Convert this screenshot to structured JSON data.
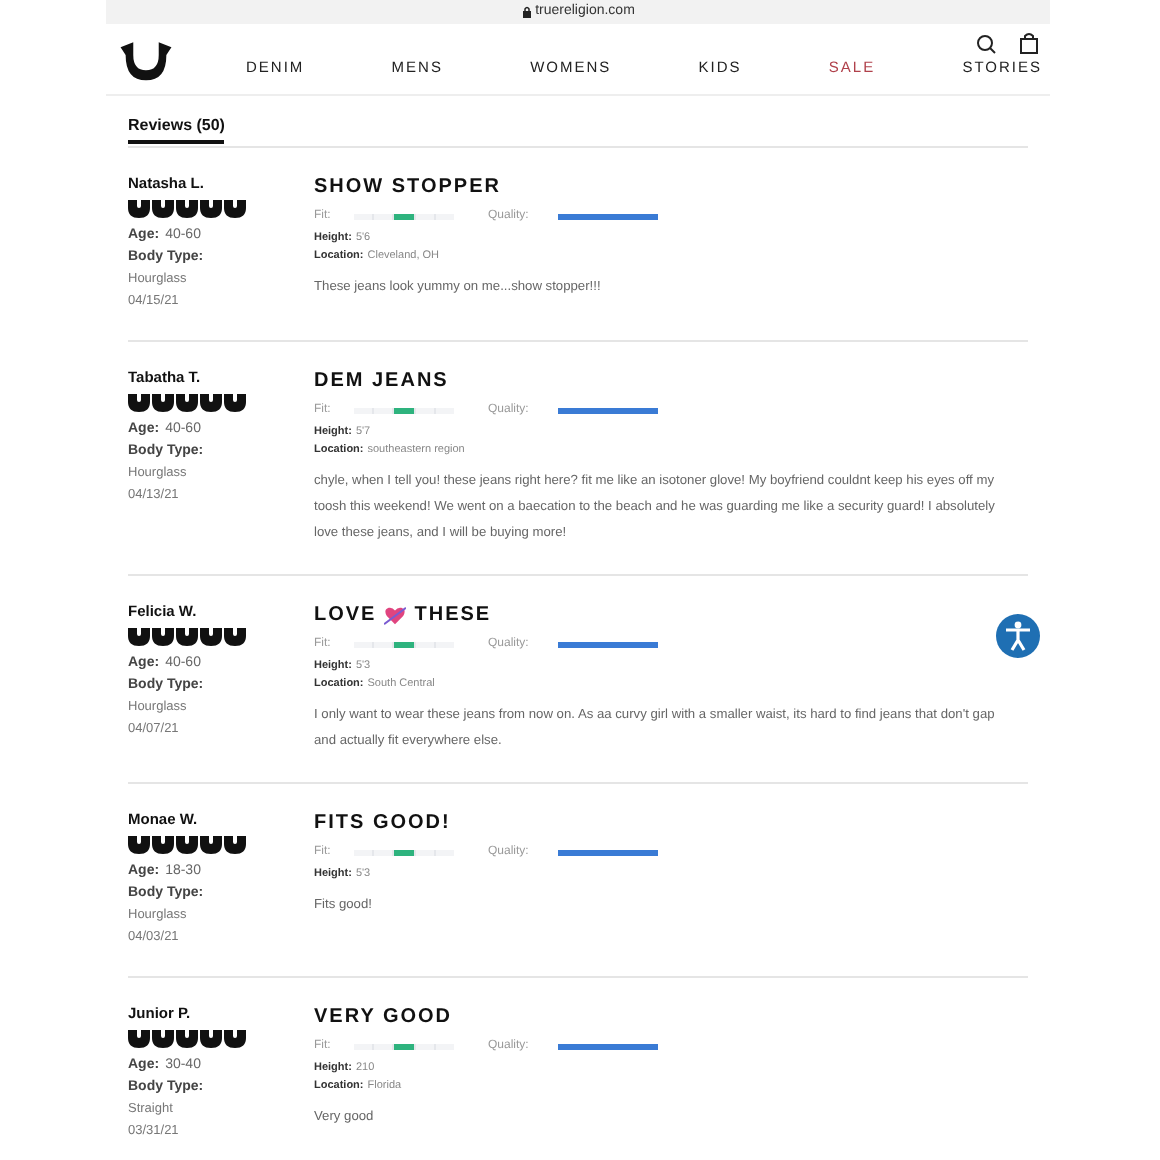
{
  "browser": {
    "url": "truereligion.com"
  },
  "nav": [
    {
      "label": "DENIM",
      "kind": "normal"
    },
    {
      "label": "MENS",
      "kind": "normal"
    },
    {
      "label": "WOMENS",
      "kind": "normal"
    },
    {
      "label": "KIDS",
      "kind": "normal"
    },
    {
      "label": "SALE",
      "kind": "sale"
    },
    {
      "label": "STORIES",
      "kind": "normal"
    }
  ],
  "reviews_tab": {
    "label": "Reviews (50)",
    "selected": true
  },
  "reviews": [
    {
      "name": "Natasha L.",
      "stars": 5,
      "age_label": "Age:",
      "age": "40-60",
      "body_type_label": "Body Type:",
      "body_type": "Hourglass",
      "date": "04/15/21",
      "title": [
        "SHOW STOPPER"
      ],
      "fit_label": "Fit:",
      "fit": {
        "level": 0.5
      },
      "quality_label": "Quality:",
      "quality": {
        "level": 1
      },
      "details": [
        {
          "label": "Height:",
          "value": "5'6"
        },
        {
          "label": "Location:",
          "value": "Cleveland, OH"
        }
      ],
      "text": "These jeans look yummy on me...show stopper!!!"
    },
    {
      "name": "Tabatha T.",
      "stars": 5,
      "age_label": "Age:",
      "age": "40-60",
      "body_type_label": "Body Type:",
      "body_type": "Hourglass",
      "date": "04/13/21",
      "title": [
        "DEM JEANS"
      ],
      "fit_label": "Fit:",
      "fit": {
        "level": 0.5
      },
      "quality_label": "Quality:",
      "quality": {
        "level": 1
      },
      "details": [
        {
          "label": "Height:",
          "value": "5'7"
        },
        {
          "label": "Location:",
          "value": "southeastern region"
        }
      ],
      "text": "chyle, when I tell you! these jeans right here? fit me like an isotoner glove! My boyfriend couldnt keep his eyes off my toosh this weekend! We went on a baecation to the beach and he was guarding me like a security guard! I absolutely love these jeans, and I will be buying more!"
    },
    {
      "name": "Felicia W.",
      "stars": 5,
      "age_label": "Age:",
      "age": "40-60",
      "body_type_label": "Body Type:",
      "body_type": "Hourglass",
      "date": "04/07/21",
      "title": [
        "LOVE",
        "THESE"
      ],
      "fit_label": "Fit:",
      "fit": {
        "level": 0.5
      },
      "quality_label": "Quality:",
      "quality": {
        "level": 1
      },
      "details": [
        {
          "label": "Height:",
          "value": "5'3"
        },
        {
          "label": "Location:",
          "value": "South Central"
        }
      ],
      "text": "I only want to wear these jeans from now on. As aa curvy girl with a smaller waist, its hard to find jeans that don't gap and actually fit everywhere else."
    },
    {
      "name": "Monae W.",
      "stars": 5,
      "age_label": "Age:",
      "age": "18-30",
      "body_type_label": "Body Type:",
      "body_type": "Hourglass",
      "date": "04/03/21",
      "title": [
        "FITS GOOD!"
      ],
      "fit_label": "Fit:",
      "fit": {
        "level": 0.5
      },
      "quality_label": "Quality:",
      "quality": {
        "level": 1
      },
      "details": [
        {
          "label": "Height:",
          "value": "5'3"
        }
      ],
      "text": "Fits good!"
    },
    {
      "name": "Junior P.",
      "stars": 5,
      "age_label": "Age:",
      "age": "30-40",
      "body_type_label": "Body Type:",
      "body_type": "Straight",
      "date": "03/31/21",
      "title": [
        "VERY GOOD"
      ],
      "fit_label": "Fit:",
      "fit": {
        "level": 0.5
      },
      "quality_label": "Quality:",
      "quality": {
        "level": 1
      },
      "details": [
        {
          "label": "Height:",
          "value": "210"
        },
        {
          "label": "Location:",
          "value": "Florida"
        }
      ],
      "text": "Very good"
    }
  ]
}
